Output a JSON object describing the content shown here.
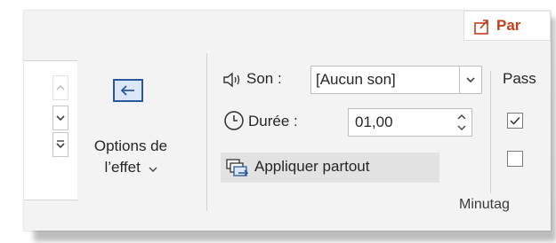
{
  "ribbon": {
    "top_tab": {
      "label": "Par",
      "icon": "share-icon",
      "color": "#c43e1c"
    },
    "gallery": {
      "scroll_up_icon": "chevron-up-icon",
      "scroll_down_icon": "chevron-down-icon",
      "more_icon": "gallery-more-icon"
    },
    "effect_options": {
      "label_line1": "Options de",
      "label_line2": "l’effet",
      "icon": "arrow-left-box-icon",
      "dropdown_icon": "chevron-down-icon"
    },
    "timing": {
      "sound_label": "Son :",
      "sound_value": "[Aucun son]",
      "sound_icon": "speaker-icon",
      "duration_label": "Durée :",
      "duration_value": "01,00",
      "duration_icon": "clock-icon",
      "apply_all_label": "Appliquer partout",
      "apply_all_icon": "apply-all-icon",
      "group_label": "Minutag"
    },
    "advance": {
      "label": "Pass",
      "checkbox1_checked": true,
      "checkbox2_checked": false
    },
    "colors": {
      "accent_blue": "#2b579a",
      "ribbon_bg": "#f3f3f3",
      "hover_bg": "#e2e2e2"
    }
  }
}
